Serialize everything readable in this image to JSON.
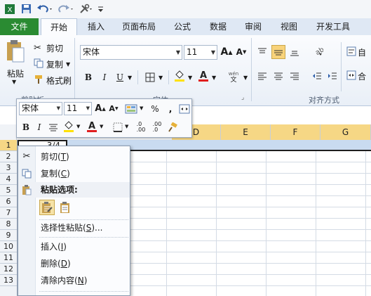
{
  "tabs": [
    {
      "label": "文件",
      "active": false
    },
    {
      "label": "开始",
      "active": true
    },
    {
      "label": "插入"
    },
    {
      "label": "页面布局"
    },
    {
      "label": "公式"
    },
    {
      "label": "数据"
    },
    {
      "label": "审阅"
    },
    {
      "label": "视图"
    },
    {
      "label": "开发工具"
    }
  ],
  "ribbon": {
    "paste_label": "粘贴",
    "cut_label": "剪切",
    "copy_label": "复制",
    "format_painter_label": "格式刷",
    "clipboard_group": "剪贴板",
    "font_name": "宋体",
    "font_size": "11",
    "font_group": "字体",
    "bold": "B",
    "italic": "I",
    "underline": "U",
    "wrap_label": "自",
    "merge_label": "合",
    "align_group": "对齐方式"
  },
  "mini_toolbar": {
    "font_name": "宋体",
    "font_size": "11",
    "percent": "%",
    "comma": ",",
    "bold": "B",
    "italic": "I",
    "dec_inc": ".0\n.00",
    "dec_dec": ".00\n.0"
  },
  "grid": {
    "columns": [
      "D",
      "E",
      "F",
      "G"
    ],
    "rows": [
      "1",
      "2",
      "3",
      "4",
      "5",
      "6",
      "7",
      "8",
      "9",
      "10",
      "11",
      "12",
      "13"
    ],
    "active_value": "3/4"
  },
  "context_menu": {
    "cut": {
      "label": "剪切",
      "key": "T"
    },
    "copy": {
      "label": "复制",
      "key": "C"
    },
    "paste_options_header": "粘贴选项:",
    "paste_special": {
      "label": "选择性粘贴",
      "key": "S",
      "suffix": "..."
    },
    "insert": {
      "label": "插入",
      "key": "I"
    },
    "delete": {
      "label": "删除",
      "key": "D"
    },
    "clear": {
      "label": "清除内容",
      "key": "N"
    }
  },
  "colors": {
    "accent_file": "#2a8b32",
    "selection": "#f6d785",
    "row_select": "#c9dbf0"
  }
}
